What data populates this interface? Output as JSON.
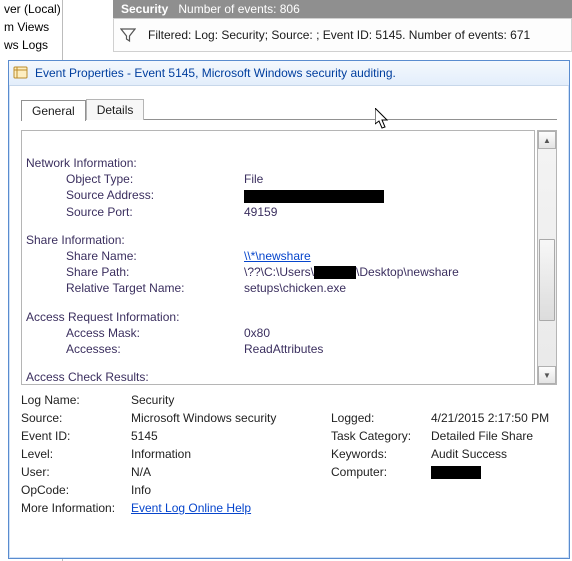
{
  "tree": {
    "items": [
      "ver (Local)",
      "m Views",
      "ws Logs"
    ]
  },
  "header": {
    "title": "Security",
    "count_label": "Number of events: 806"
  },
  "filter": {
    "text": "Filtered: Log: Security; Source: ; Event ID: 5145. Number of events: 671"
  },
  "dialog": {
    "title": "Event Properties - Event 5145, Microsoft Windows security auditing."
  },
  "tabs": {
    "general": "General",
    "details": "Details"
  },
  "body": {
    "net_info_label": "Network Information:",
    "object_type_label": "Object Type:",
    "object_type_value": "File",
    "source_address_label": "Source Address:",
    "source_port_label": "Source Port:",
    "source_port_value": "49159",
    "share_info_label": "Share Information:",
    "share_name_label": "Share Name:",
    "share_name_value": "\\\\*\\newshare",
    "share_path_label": "Share Path:",
    "share_path_prefix": "\\??\\C:\\Users\\",
    "share_path_suffix": "\\Desktop\\newshare",
    "rel_target_label": "Relative Target Name:",
    "rel_target_value": "setups\\chicken.exe",
    "access_req_label": "Access Request Information:",
    "access_mask_label": "Access Mask:",
    "access_mask_value": "0x80",
    "accesses_label": "Accesses:",
    "accesses_value": "ReadAttributes",
    "access_check_label": "Access Check Results:"
  },
  "summary": {
    "log_name_label": "Log Name:",
    "log_name_value": "Security",
    "source_label": "Source:",
    "source_value": "Microsoft Windows security",
    "logged_label": "Logged:",
    "logged_value": "4/21/2015 2:17:50 PM",
    "event_id_label": "Event ID:",
    "event_id_value": "5145",
    "task_cat_label": "Task Category:",
    "task_cat_value": "Detailed File Share",
    "level_label": "Level:",
    "level_value": "Information",
    "keywords_label": "Keywords:",
    "keywords_value": "Audit Success",
    "user_label": "User:",
    "user_value": "N/A",
    "computer_label": "Computer:",
    "opcode_label": "OpCode:",
    "opcode_value": "Info",
    "more_info_label": "More Information:",
    "more_info_link": "Event Log Online Help"
  }
}
